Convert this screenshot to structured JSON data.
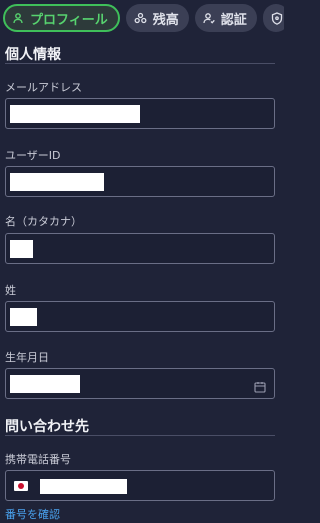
{
  "tabs": [
    {
      "label": "プロフィール",
      "icon": "user-icon",
      "active": true
    },
    {
      "label": "残高",
      "icon": "coins-icon",
      "active": false
    },
    {
      "label": "認証",
      "icon": "user-check-icon",
      "active": false
    },
    {
      "label": "",
      "icon": "shield-icon",
      "active": false
    }
  ],
  "personal": {
    "title": "個人情報",
    "email_label": "メールアドレス",
    "userid_label": "ユーザーID",
    "firstname_label": "名（カタカナ）",
    "lastname_label": "姓",
    "birthdate_label": "生年月日"
  },
  "contact": {
    "title": "問い合わせ先",
    "phone_label": "携帯電話番号",
    "verify_link": "番号を確認"
  },
  "colors": {
    "background": "#1f2338",
    "accent": "#3fbf5a",
    "link": "#4aa3f0"
  }
}
